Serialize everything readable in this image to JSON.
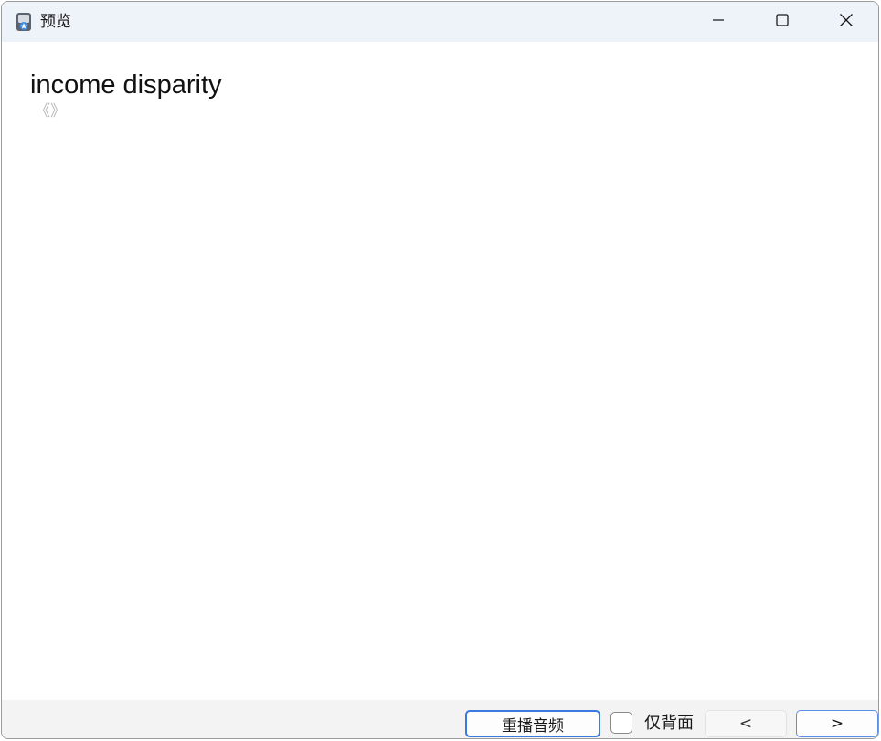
{
  "window": {
    "title": "预览"
  },
  "card": {
    "word": "income disparity",
    "phonetic": "《》"
  },
  "toolbar": {
    "replay_label": "重播音频",
    "back_only_label": "仅背面",
    "back_only_checked": false,
    "prev_label": "<",
    "next_label": ">"
  },
  "icons": {
    "app": "app-icon",
    "minimize": "minimize-icon",
    "maximize": "maximize-icon",
    "close": "close-icon"
  },
  "colors": {
    "titlebar_bg": "#eef2f9",
    "accent": "#3b78e0",
    "phonetic": "#b8b8b8"
  }
}
